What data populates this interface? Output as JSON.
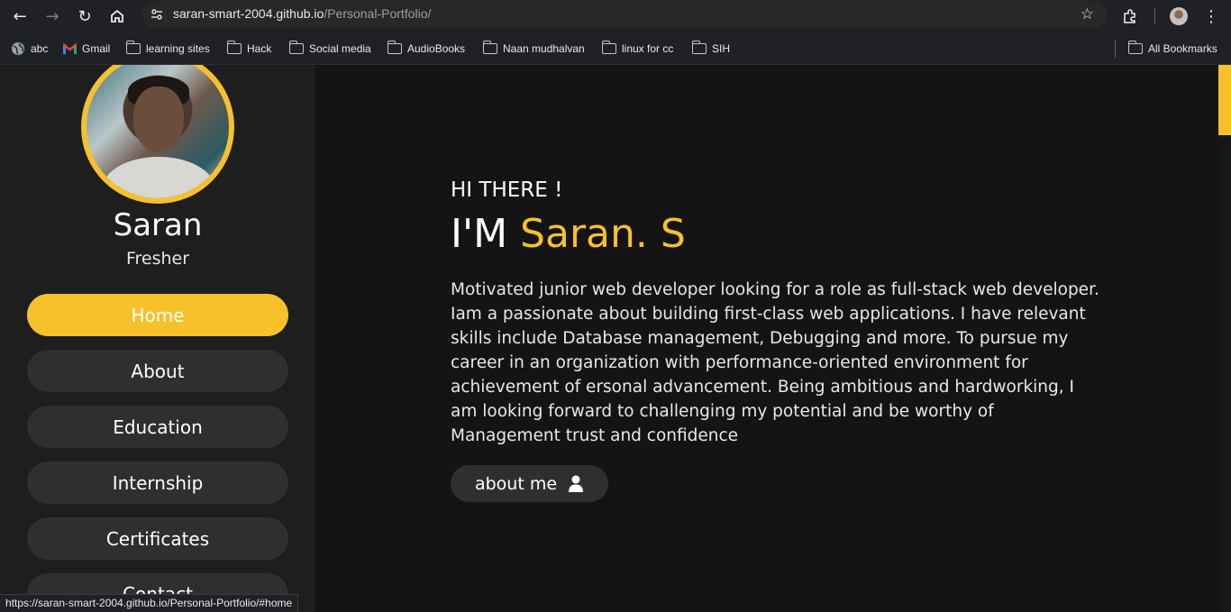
{
  "browser": {
    "url_host": "saran-smart-2004.github.io",
    "url_path": "/Personal-Portfolio/",
    "bookmarks": [
      {
        "label": "abc",
        "icon": "globe-icon"
      },
      {
        "label": "Gmail",
        "icon": "gmail-icon"
      },
      {
        "label": "learning sites",
        "icon": "folder-icon"
      },
      {
        "label": "Hack",
        "icon": "folder-icon"
      },
      {
        "label": "Social media",
        "icon": "folder-icon"
      },
      {
        "label": "AudioBooks",
        "icon": "folder-icon"
      },
      {
        "label": "Naan mudhalvan",
        "icon": "folder-icon"
      },
      {
        "label": "linux for cc",
        "icon": "folder-icon"
      },
      {
        "label": "SIH",
        "icon": "folder-icon"
      }
    ],
    "all_bookmarks": "All Bookmarks",
    "status_url": "https://saran-smart-2004.github.io/Personal-Portfolio/#home"
  },
  "sidebar": {
    "name": "Saran",
    "role": "Fresher",
    "nav": [
      {
        "label": "Home",
        "active": true
      },
      {
        "label": "About",
        "active": false
      },
      {
        "label": "Education",
        "active": false
      },
      {
        "label": "Internship",
        "active": false
      },
      {
        "label": "Certificates",
        "active": false
      },
      {
        "label": "Contact",
        "active": false
      }
    ]
  },
  "hero": {
    "greeting": "HI THERE !",
    "intro_prefix": "I'M",
    "intro_name": "Saran. S",
    "bio": "Motivated junior web developer looking for a role as full-stack web developer. Iam a passionate about building first-class web applications. I have relevant skills include Database management, Debugging and more. To pursue my career in an organization with performance-oriented environment for achievement of ersonal advancement. Being ambitious and hardworking, I am looking forward to challenging my potential and be worthy of Management trust and confidence",
    "cta_label": "about me"
  },
  "colors": {
    "accent": "#f7c12b",
    "sidebar_bg": "#1e1e1e",
    "main_bg": "#141414",
    "button_bg": "#2f2f2f"
  }
}
